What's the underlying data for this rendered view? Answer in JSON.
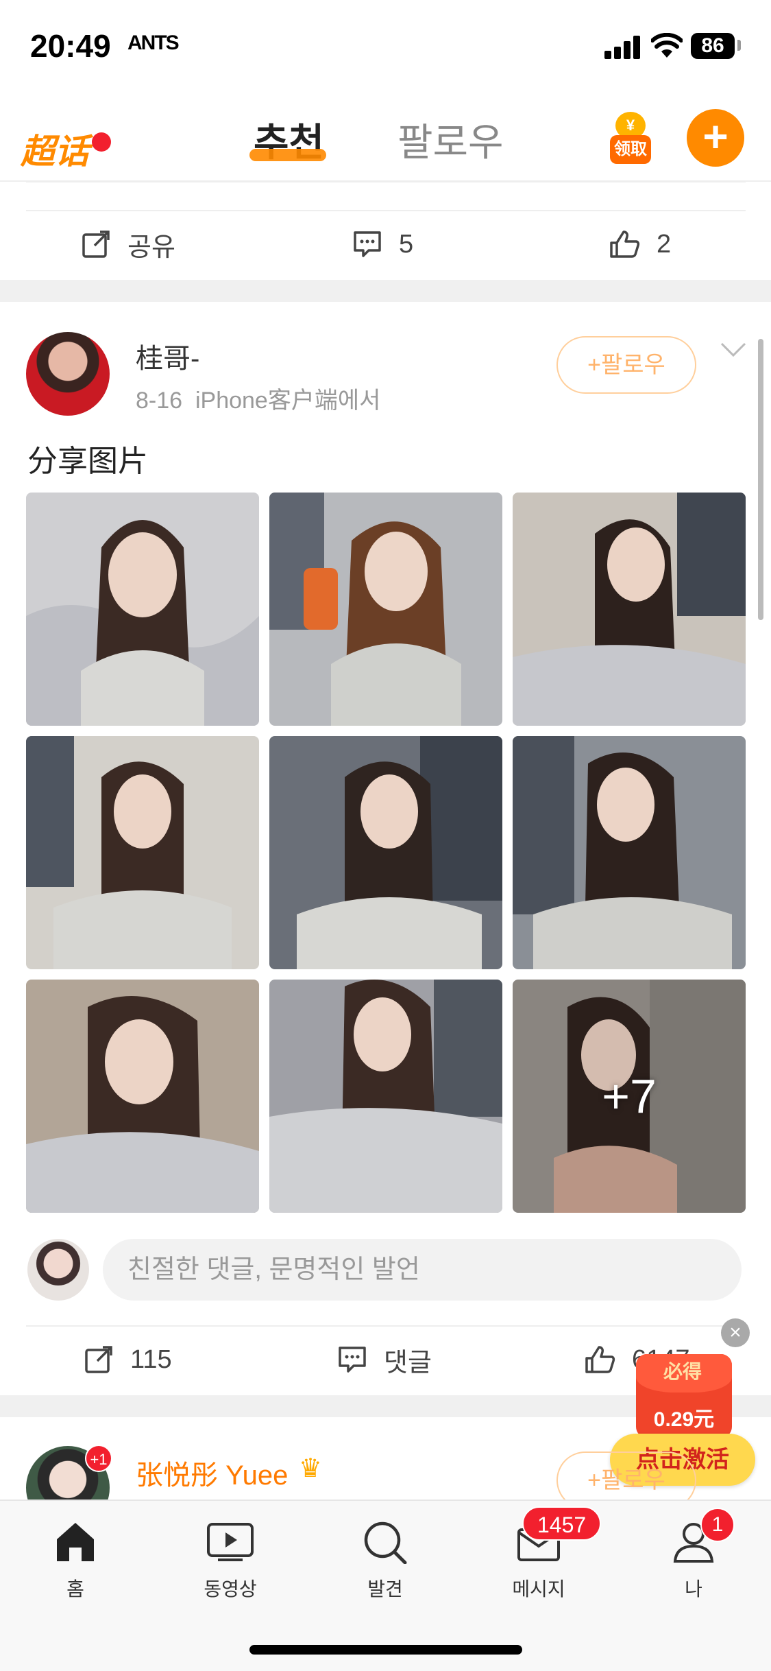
{
  "status_bar": {
    "time": "20:49",
    "ants_label": "ANTS",
    "battery": "86"
  },
  "top_nav": {
    "logo_text": "超话",
    "tabs": [
      {
        "label": "추천",
        "active": true
      },
      {
        "label": "팔로우",
        "active": false
      }
    ],
    "coin_label": "领取",
    "coin_symbol": "¥",
    "plus_symbol": "+"
  },
  "post_prev": {
    "actions": {
      "share_label": "공유",
      "comment_count": "5",
      "like_count": "2"
    }
  },
  "post": {
    "author": "桂哥-",
    "date": "8-16",
    "source": "iPhone客户端에서",
    "follow_label": "+팔로우",
    "text": "分享图片",
    "extra_images": "+7",
    "comment_placeholder": "친절한 댓글, 문명적인 발언",
    "actions": {
      "share_count": "115",
      "comment_label": "댓글",
      "like_count": "6147"
    }
  },
  "promo": {
    "close_symbol": "×",
    "must_label": "必得",
    "amount": "0.29元",
    "button_label": "点击激活"
  },
  "post_next": {
    "author": "张悦彤 Yuee",
    "badge": "+1",
    "follow_label": "+팔로우"
  },
  "tab_bar": {
    "items": [
      {
        "label": "홈",
        "icon": "home-icon"
      },
      {
        "label": "동영상",
        "icon": "video-icon"
      },
      {
        "label": "발견",
        "icon": "search-icon"
      },
      {
        "label": "메시지",
        "icon": "message-icon"
      },
      {
        "label": "나",
        "icon": "profile-icon"
      }
    ],
    "messages_badge": "1457",
    "me_badge": "1"
  },
  "colors": {
    "accent": "#ff8a00",
    "badge_red": "#f2202e",
    "follow_border": "#ffcf9c"
  }
}
